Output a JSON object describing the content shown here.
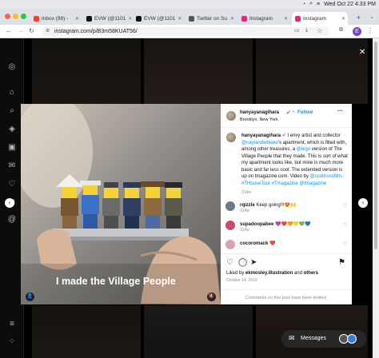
{
  "menubar": {
    "datetime": "Wed Oct 22  4:33 PM"
  },
  "tabs": [
    {
      "label": "Inbox (99) -",
      "favicon_color": "#ea4335"
    },
    {
      "label": "EVW (@1101",
      "favicon_color": "#111111"
    },
    {
      "label": "EVW (@1101",
      "favicon_color": "#111111"
    },
    {
      "label": "Twitter on Su",
      "favicon_color": "#555555"
    },
    {
      "label": "Instagram",
      "favicon_color": "#dd2a7b"
    },
    {
      "label": "Instagram",
      "favicon_color": "#dd2a7b"
    }
  ],
  "address": {
    "url": "instagram.com/p/B3m58KUAT56/",
    "profile_initial": "E"
  },
  "post": {
    "username": "hanyayanagihara",
    "verified_icon": "verified-badge-icon",
    "follow_label": "Follow",
    "location": "Brooklyn, New York",
    "more_label": "···",
    "caption_user": "hanyayanagihara",
    "caption_parts": [
      {
        "text": " I envy artist and collector ",
        "link": false
      },
      {
        "text": "@naylandwblake",
        "link": true
      },
      {
        "text": "'s apartment, which is filled with, among other treasures, a ",
        "link": false
      },
      {
        "text": "@lego",
        "link": true
      },
      {
        "text": " version of The Village People that they made. This is sort of what my apartment looks like, but mine is much more basic and far less cool. The extended version is up on tmagazine.com. Video by ",
        "link": false
      },
      {
        "text": "@scottrossfilm",
        "link": true
      },
      {
        "text": ". ",
        "link": false
      },
      {
        "text": "#THouseTour #Tmagazine",
        "link": true
      },
      {
        "text": " ",
        "link": false
      },
      {
        "text": "@tmagazine",
        "link": true
      }
    ],
    "caption_time": "314w",
    "video_overlay_text": "I made the Village People",
    "comments": [
      {
        "user": "rqizzle",
        "text": " Keep going!!!😍🙌",
        "time": "314w",
        "avatar_color": "#6b7a89"
      },
      {
        "user": "supadoopabee",
        "text": " 💜❤️🧡💛💚💙",
        "time": "314w",
        "avatar_color": "#c44d6a"
      },
      {
        "user": "cocoromack",
        "text": " ❤️",
        "time": "",
        "avatar_color": "#d9a2b2"
      }
    ],
    "likes_text": "Liked by ",
    "likes_user": "ekmosley.illustration",
    "likes_and": " and ",
    "likes_others": "others",
    "date": "October 14, 2019",
    "comments_limited": "Comments on this post have been limited."
  },
  "messages_label": "Messages",
  "colors": {
    "instagram_blue": "#0095f6",
    "follow_blue": "#0095f6"
  }
}
